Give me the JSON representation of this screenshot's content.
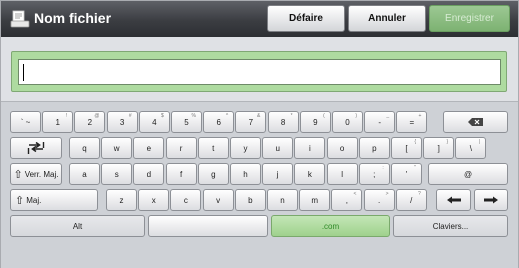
{
  "header": {
    "title": "Nom fichier",
    "title_icon": "document-scanner-icon",
    "undo_label": "Défaire",
    "cancel_label": "Annuler",
    "save_label": "Enregistrer"
  },
  "input": {
    "value": "",
    "panel_color": "#aedba0"
  },
  "keyboard": {
    "row1": [
      {
        "main": "` ~",
        "shift": ""
      },
      {
        "main": "1",
        "shift": "!"
      },
      {
        "main": "2",
        "shift": "@"
      },
      {
        "main": "3",
        "shift": "#"
      },
      {
        "main": "4",
        "shift": "$"
      },
      {
        "main": "5",
        "shift": "%"
      },
      {
        "main": "6",
        "shift": "^"
      },
      {
        "main": "7",
        "shift": "&"
      },
      {
        "main": "8",
        "shift": "*"
      },
      {
        "main": "9",
        "shift": "("
      },
      {
        "main": "0",
        "shift": ")"
      },
      {
        "main": "-",
        "shift": "_"
      },
      {
        "main": "=",
        "shift": "+"
      }
    ],
    "backspace_icon": "backspace-icon",
    "row2": [
      {
        "main": "q",
        "shift": ""
      },
      {
        "main": "w",
        "shift": ""
      },
      {
        "main": "e",
        "shift": ""
      },
      {
        "main": "r",
        "shift": ""
      },
      {
        "main": "t",
        "shift": ""
      },
      {
        "main": "y",
        "shift": ""
      },
      {
        "main": "u",
        "shift": ""
      },
      {
        "main": "i",
        "shift": ""
      },
      {
        "main": "o",
        "shift": ""
      },
      {
        "main": "p",
        "shift": ""
      },
      {
        "main": "[",
        "shift": "{"
      },
      {
        "main": "]",
        "shift": "}"
      },
      {
        "main": "\\",
        "shift": "|"
      }
    ],
    "tab_icon": "tab-icon",
    "caps_label": "Verr. Maj.",
    "row3": [
      {
        "main": "a",
        "shift": ""
      },
      {
        "main": "s",
        "shift": ""
      },
      {
        "main": "d",
        "shift": ""
      },
      {
        "main": "f",
        "shift": ""
      },
      {
        "main": "g",
        "shift": ""
      },
      {
        "main": "h",
        "shift": ""
      },
      {
        "main": "j",
        "shift": ""
      },
      {
        "main": "k",
        "shift": ""
      },
      {
        "main": "l",
        "shift": ""
      },
      {
        "main": ";",
        "shift": ":"
      },
      {
        "main": "'",
        "shift": "\""
      },
      {
        "main": "@",
        "shift": ""
      }
    ],
    "shift_label": "Maj.",
    "row4": [
      {
        "main": "z",
        "shift": ""
      },
      {
        "main": "x",
        "shift": ""
      },
      {
        "main": "c",
        "shift": ""
      },
      {
        "main": "v",
        "shift": ""
      },
      {
        "main": "b",
        "shift": ""
      },
      {
        "main": "n",
        "shift": ""
      },
      {
        "main": "m",
        "shift": ""
      },
      {
        "main": ",",
        "shift": "<"
      },
      {
        "main": ".",
        "shift": ">"
      },
      {
        "main": "/",
        "shift": "?"
      }
    ],
    "left_arrow_icon": "cursor-left-icon",
    "right_arrow_icon": "cursor-right-icon",
    "alt_label": "Alt",
    "space_label": "",
    "com_label": ".com",
    "keyboards_label": "Claviers..."
  }
}
